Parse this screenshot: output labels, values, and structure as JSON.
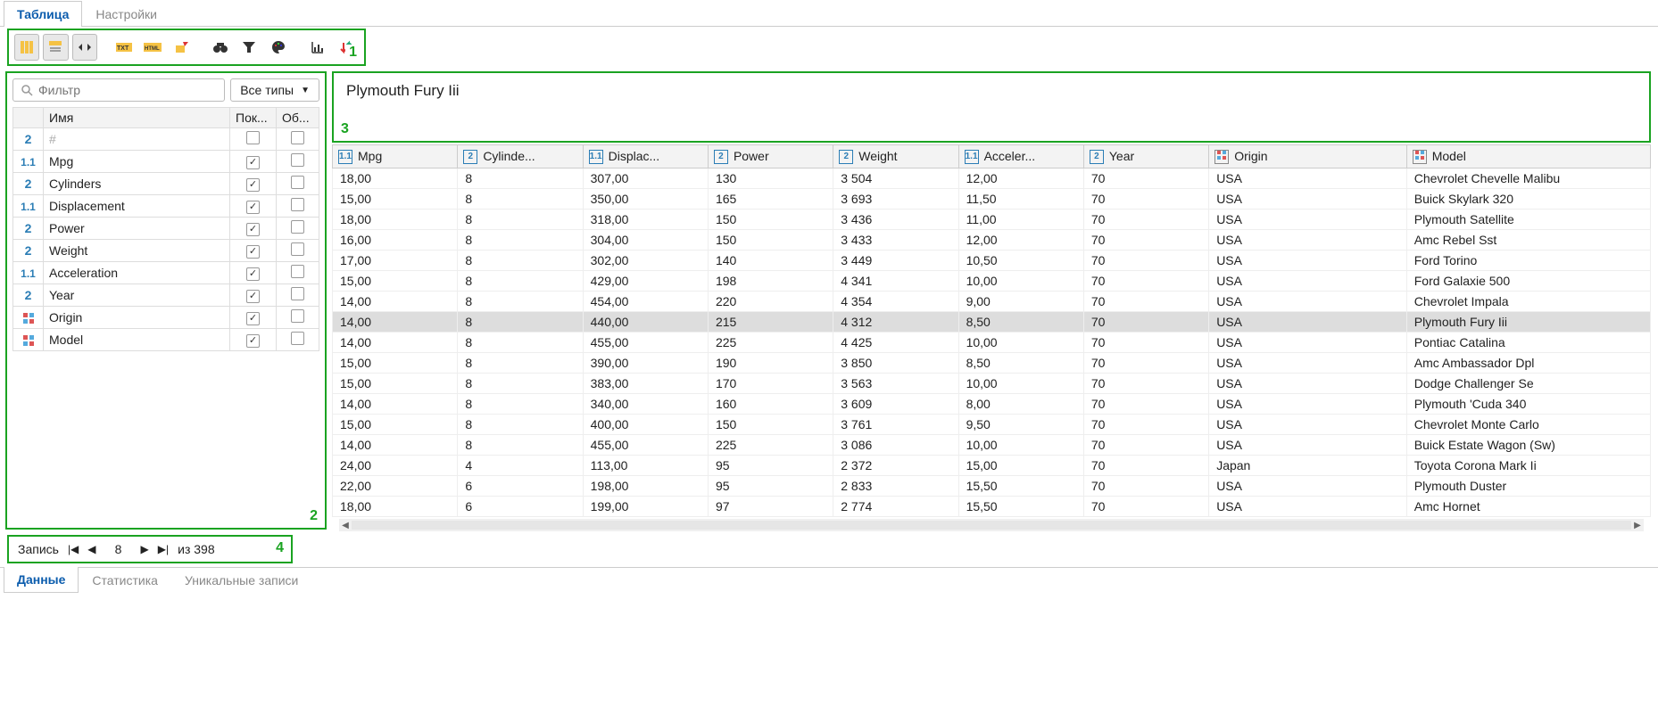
{
  "top_tabs": {
    "table": "Таблица",
    "settings": "Настройки"
  },
  "annot": {
    "l1": "1",
    "l2": "2",
    "l3": "3",
    "l4": "4"
  },
  "filter": {
    "placeholder": "Фильтр",
    "all_types": "Все типы"
  },
  "cols_header": {
    "name": "Имя",
    "show": "Пок...",
    "obj": "Об..."
  },
  "columns": [
    {
      "type": "num",
      "name": "#",
      "show": false,
      "obj": false
    },
    {
      "type": "dec",
      "name": "Mpg",
      "show": true,
      "obj": false
    },
    {
      "type": "num",
      "name": "Cylinders",
      "show": true,
      "obj": false
    },
    {
      "type": "dec",
      "name": "Displacement",
      "show": true,
      "obj": false
    },
    {
      "type": "num",
      "name": "Power",
      "show": true,
      "obj": false
    },
    {
      "type": "num",
      "name": "Weight",
      "show": true,
      "obj": false
    },
    {
      "type": "dec",
      "name": "Acceleration",
      "show": true,
      "obj": false
    },
    {
      "type": "num",
      "name": "Year",
      "show": true,
      "obj": false
    },
    {
      "type": "cat",
      "name": "Origin",
      "show": true,
      "obj": false
    },
    {
      "type": "cat",
      "name": "Model",
      "show": true,
      "obj": false
    }
  ],
  "selected_cell": "Plymouth Fury Iii",
  "data_headers": [
    {
      "type": "dec",
      "label": "Mpg"
    },
    {
      "type": "num",
      "label": "Cylinde..."
    },
    {
      "type": "dec",
      "label": "Displac..."
    },
    {
      "type": "num",
      "label": "Power"
    },
    {
      "type": "num",
      "label": "Weight"
    },
    {
      "type": "dec",
      "label": "Acceler..."
    },
    {
      "type": "num",
      "label": "Year"
    },
    {
      "type": "cat",
      "label": "Origin"
    },
    {
      "type": "cat",
      "label": "Model"
    }
  ],
  "selected_row_index": 7,
  "rows": [
    [
      "18,00",
      "8",
      "307,00",
      "130",
      "3 504",
      "12,00",
      "70",
      "USA",
      "Chevrolet Chevelle Malibu"
    ],
    [
      "15,00",
      "8",
      "350,00",
      "165",
      "3 693",
      "11,50",
      "70",
      "USA",
      "Buick Skylark 320"
    ],
    [
      "18,00",
      "8",
      "318,00",
      "150",
      "3 436",
      "11,00",
      "70",
      "USA",
      "Plymouth Satellite"
    ],
    [
      "16,00",
      "8",
      "304,00",
      "150",
      "3 433",
      "12,00",
      "70",
      "USA",
      "Amc Rebel Sst"
    ],
    [
      "17,00",
      "8",
      "302,00",
      "140",
      "3 449",
      "10,50",
      "70",
      "USA",
      "Ford Torino"
    ],
    [
      "15,00",
      "8",
      "429,00",
      "198",
      "4 341",
      "10,00",
      "70",
      "USA",
      "Ford Galaxie 500"
    ],
    [
      "14,00",
      "8",
      "454,00",
      "220",
      "4 354",
      "9,00",
      "70",
      "USA",
      "Chevrolet Impala"
    ],
    [
      "14,00",
      "8",
      "440,00",
      "215",
      "4 312",
      "8,50",
      "70",
      "USA",
      "Plymouth Fury Iii"
    ],
    [
      "14,00",
      "8",
      "455,00",
      "225",
      "4 425",
      "10,00",
      "70",
      "USA",
      "Pontiac Catalina"
    ],
    [
      "15,00",
      "8",
      "390,00",
      "190",
      "3 850",
      "8,50",
      "70",
      "USA",
      "Amc Ambassador Dpl"
    ],
    [
      "15,00",
      "8",
      "383,00",
      "170",
      "3 563",
      "10,00",
      "70",
      "USA",
      "Dodge Challenger Se"
    ],
    [
      "14,00",
      "8",
      "340,00",
      "160",
      "3 609",
      "8,00",
      "70",
      "USA",
      "Plymouth 'Cuda 340"
    ],
    [
      "15,00",
      "8",
      "400,00",
      "150",
      "3 761",
      "9,50",
      "70",
      "USA",
      "Chevrolet Monte Carlo"
    ],
    [
      "14,00",
      "8",
      "455,00",
      "225",
      "3 086",
      "10,00",
      "70",
      "USA",
      "Buick Estate Wagon (Sw)"
    ],
    [
      "24,00",
      "4",
      "113,00",
      "95",
      "2 372",
      "15,00",
      "70",
      "Japan",
      "Toyota Corona Mark Ii"
    ],
    [
      "22,00",
      "6",
      "198,00",
      "95",
      "2 833",
      "15,50",
      "70",
      "USA",
      "Plymouth Duster"
    ],
    [
      "18,00",
      "6",
      "199,00",
      "97",
      "2 774",
      "15,50",
      "70",
      "USA",
      "Amc Hornet"
    ]
  ],
  "pager": {
    "label": "Запись",
    "current": "8",
    "of": "из 398"
  },
  "bottom_tabs": {
    "data": "Данные",
    "stats": "Статистика",
    "unique": "Уникальные записи"
  }
}
